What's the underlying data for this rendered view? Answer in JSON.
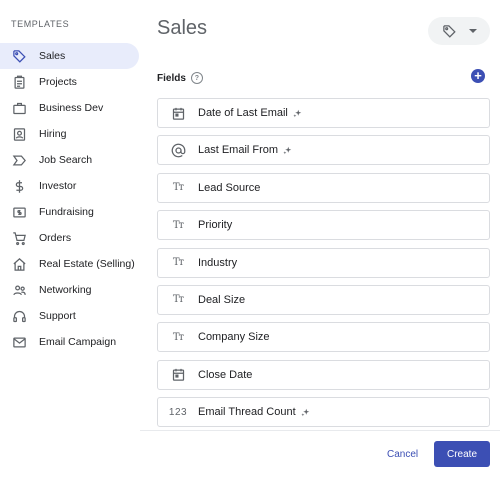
{
  "sidebar": {
    "heading": "TEMPLATES",
    "items": [
      {
        "label": "Sales",
        "icon": "tag-icon",
        "active": true
      },
      {
        "label": "Projects",
        "icon": "clipboard-icon"
      },
      {
        "label": "Business Dev",
        "icon": "briefcase-icon"
      },
      {
        "label": "Hiring",
        "icon": "badge-icon"
      },
      {
        "label": "Job Search",
        "icon": "chevron-tag-icon"
      },
      {
        "label": "Investor",
        "icon": "dollar-icon"
      },
      {
        "label": "Fundraising",
        "icon": "money-icon"
      },
      {
        "label": "Orders",
        "icon": "cart-icon"
      },
      {
        "label": "Real Estate (Selling)",
        "icon": "home-icon"
      },
      {
        "label": "Networking",
        "icon": "people-icon"
      },
      {
        "label": "Support",
        "icon": "headset-icon"
      },
      {
        "label": "Email Campaign",
        "icon": "mail-icon"
      }
    ]
  },
  "main": {
    "title": "Sales",
    "fields_label": "Fields",
    "fields": [
      {
        "label": "Date of Last Email",
        "icon": "calendar-icon",
        "sparkle": true
      },
      {
        "label": "Last Email From",
        "icon": "at-icon",
        "sparkle": true
      },
      {
        "label": "Lead Source",
        "icon": "text-type-icon"
      },
      {
        "label": "Priority",
        "icon": "text-type-icon"
      },
      {
        "label": "Industry",
        "icon": "text-type-icon"
      },
      {
        "label": "Deal Size",
        "icon": "text-type-icon"
      },
      {
        "label": "Company Size",
        "icon": "text-type-icon"
      },
      {
        "label": "Close Date",
        "icon": "calendar-icon"
      },
      {
        "label": "Email Thread Count",
        "icon": "number-icon",
        "sparkle": true
      }
    ]
  },
  "icons": {
    "text_type": "Tт",
    "number": "123"
  },
  "footer": {
    "cancel_label": "Cancel",
    "create_label": "Create"
  },
  "colors": {
    "accent": "#3c4fb4",
    "active_bg": "#e8ecfb"
  }
}
